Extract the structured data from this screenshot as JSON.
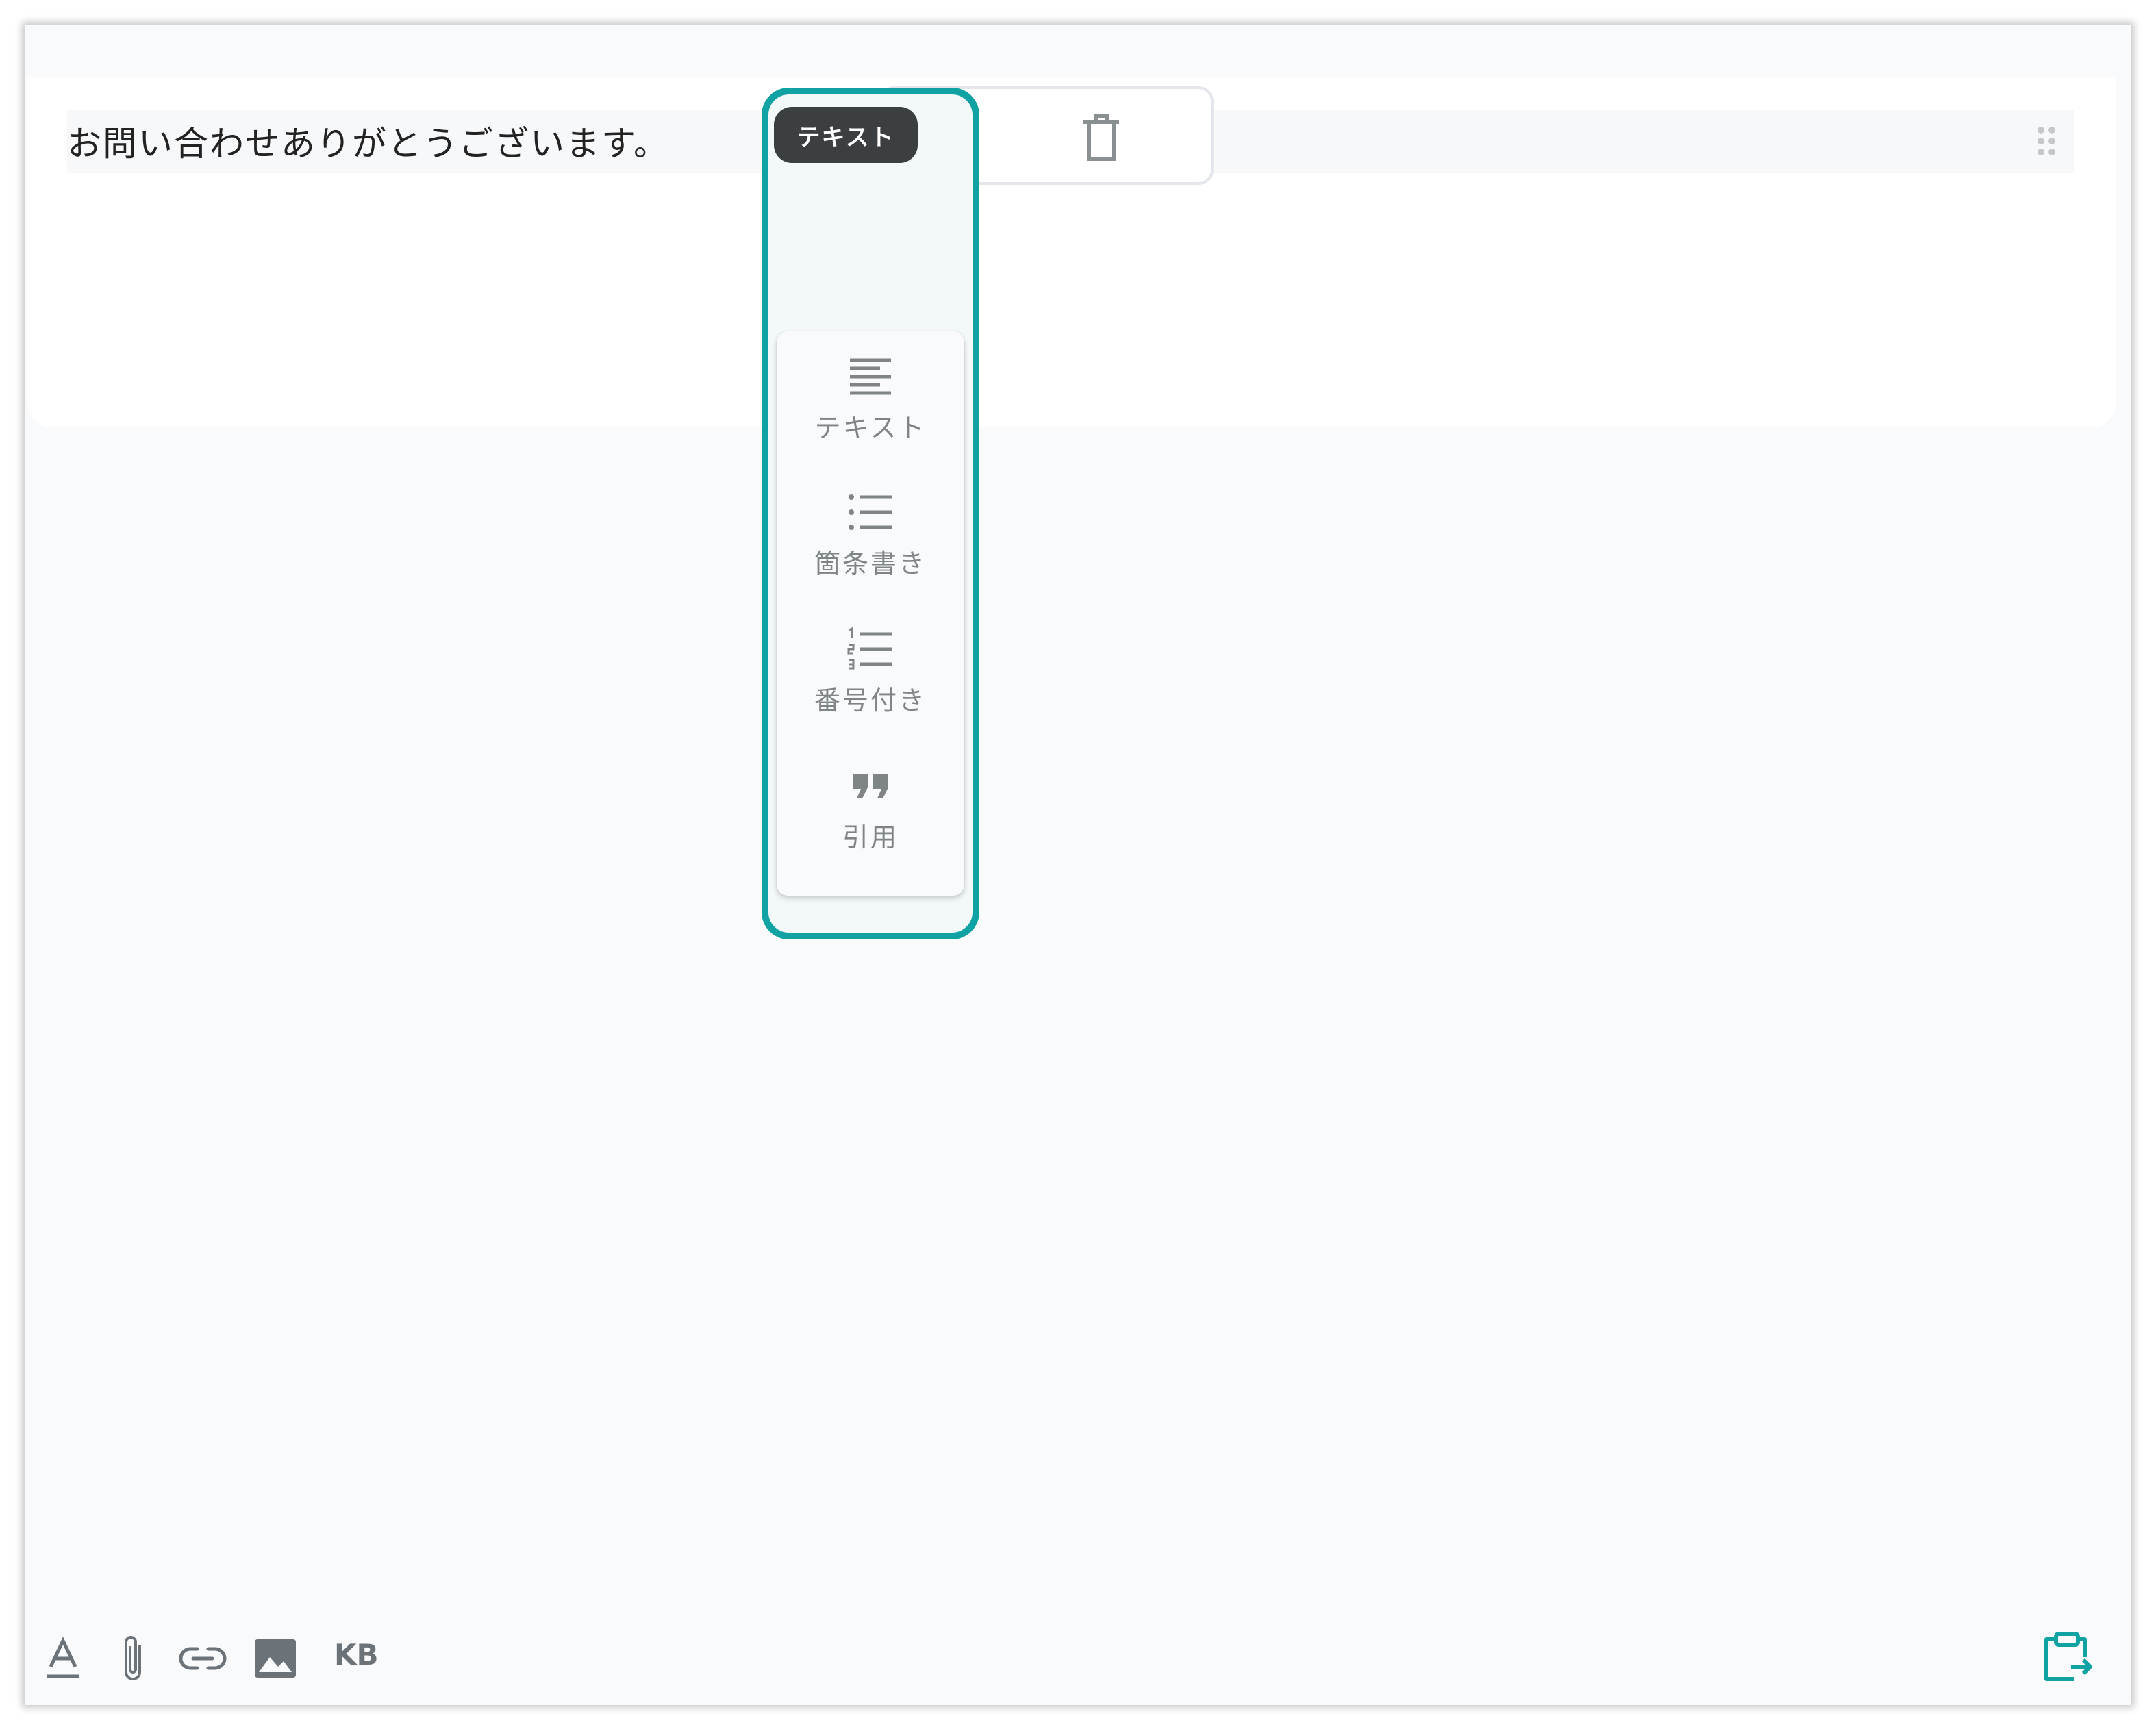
{
  "editor": {
    "block_text": "お問い合わせありがとうございます。"
  },
  "block_type_badge": "テキスト",
  "block_toolbar": {
    "icons": [
      "copy-icon",
      "trash-icon"
    ]
  },
  "type_menu": {
    "items": [
      {
        "icon": "text-align-icon",
        "label": "テキスト"
      },
      {
        "icon": "bullet-list-icon",
        "label": "箇条書き"
      },
      {
        "icon": "numbered-list-icon",
        "label": "番号付き"
      },
      {
        "icon": "quote-icon",
        "label": "引用"
      }
    ]
  },
  "bottom_toolbar": {
    "kb_label": "KB",
    "icons": [
      "text-format-icon",
      "paperclip-icon",
      "link-icon",
      "image-icon",
      "clipboard-export-icon"
    ]
  },
  "colors": {
    "accent": "#11a3a3",
    "badge_bg": "#3b3f42",
    "icon_gray": "#7f8487"
  }
}
